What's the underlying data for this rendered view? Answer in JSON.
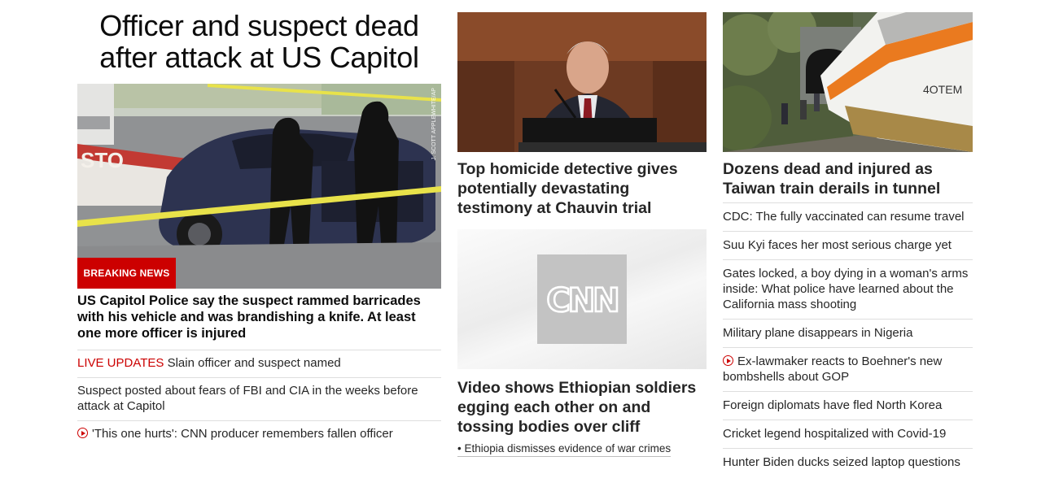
{
  "lead": {
    "headline": "Officer and suspect dead after attack at US Capitol",
    "badge": "BREAKING NEWS",
    "photo_credit": "J. SCOTT APPLEWHITE/AP",
    "summary": "US Capitol Police say the suspect rammed barricades with his vehicle and was brandishing a knife. At least one more officer is injured",
    "links": [
      {
        "prefix": "LIVE UPDATES",
        "text": " Slain officer and suspect named"
      },
      {
        "prefix": "",
        "text": "Suspect posted about fears of FBI and CIA in the weeks before attack at Capitol"
      },
      {
        "prefix": "",
        "text": "'This one hurts': CNN producer remembers fallen officer"
      }
    ]
  },
  "middle": {
    "story1": {
      "title": "Top homicide detective gives potentially devastating testimony at Chauvin trial"
    },
    "story2": {
      "logo_text": "CNN",
      "title": "Video shows Ethiopian soldiers egging each other on and tossing bodies over cliff",
      "sub": "• Ethiopia dismisses evidence of war crimes"
    }
  },
  "right": {
    "story": {
      "title": "Dozens dead and injured as Taiwan train derails in tunnel",
      "train_text": "4OTEM"
    },
    "links": [
      {
        "text": "CDC: The fully vaccinated can resume travel"
      },
      {
        "text": "Suu Kyi faces her most serious charge yet"
      },
      {
        "text": "Gates locked, a boy dying in a woman's arms inside: What police have learned about the California mass shooting"
      },
      {
        "text": "Military plane disappears in Nigeria"
      },
      {
        "text": "Ex-lawmaker reacts to Boehner's new bombshells about GOP"
      },
      {
        "text": "Foreign diplomats have fled North Korea"
      },
      {
        "text": "Cricket legend hospitalized with Covid-19"
      },
      {
        "text": "Hunter Biden ducks seized laptop questions"
      }
    ]
  },
  "colors": {
    "accent": "#cc0000",
    "text": "#262626",
    "divider": "#dedede"
  },
  "icons": {
    "video": "play-circle-icon"
  }
}
